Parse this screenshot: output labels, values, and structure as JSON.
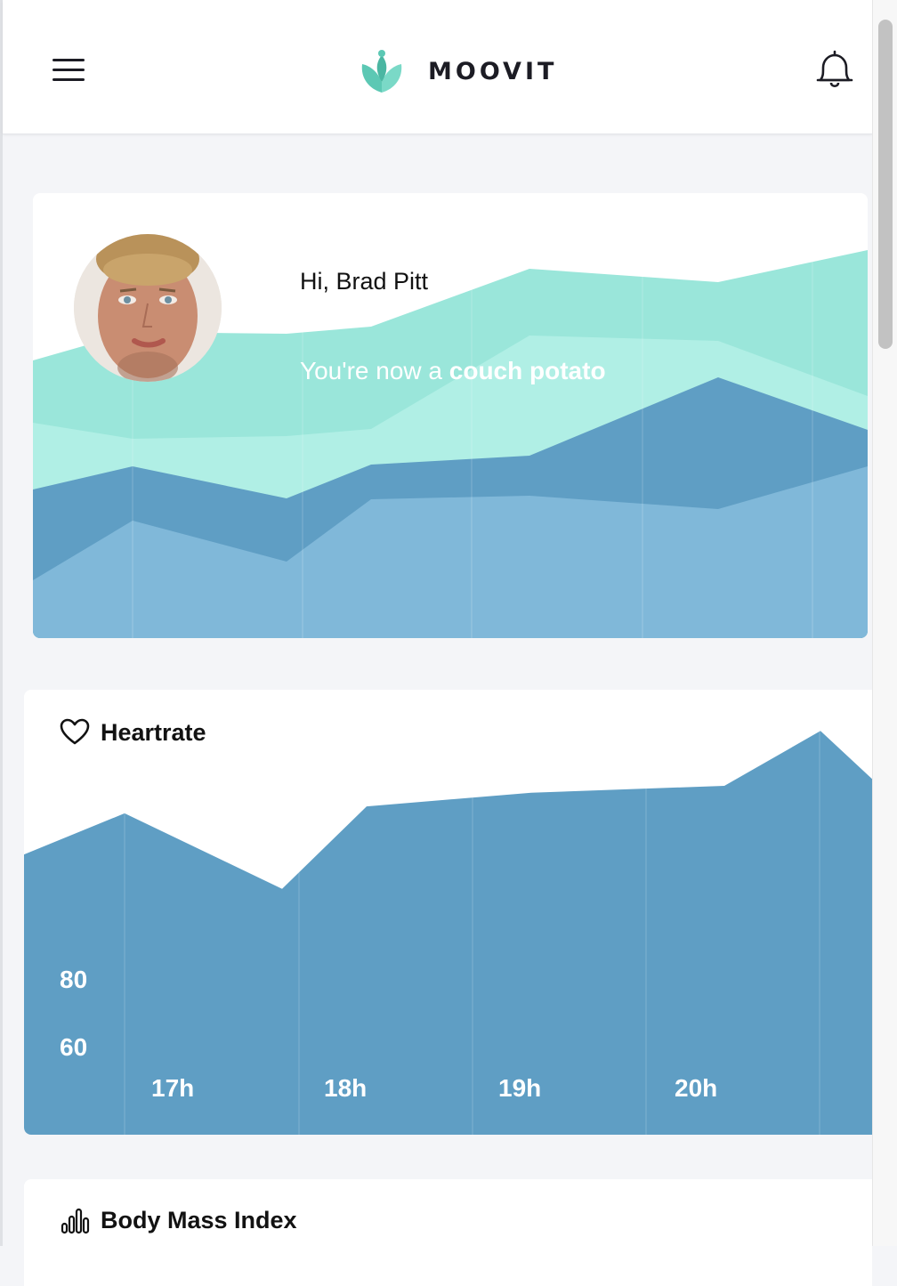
{
  "app": {
    "title": "MOOVIT",
    "menu_icon": "hamburger-menu-icon",
    "notification_icon": "bell-icon",
    "brand_color": "#6fd3c0"
  },
  "hero": {
    "greeting": "Hi, Brad Pitt",
    "status_prefix": "You're now a ",
    "status_highlight": "couch potato",
    "avatar_alt": "profile photo",
    "colors": [
      "#9ae6da",
      "#b0efe5",
      "#5f9ec4",
      "#80b8d9"
    ]
  },
  "heartrate": {
    "title": "Heartrate",
    "icon": "heart-icon",
    "color": "#5f9ec4"
  },
  "bmi": {
    "title": "Body Mass Index",
    "icon": "bar-chart-icon"
  },
  "chart_data": {
    "type": "area",
    "title": "Heartrate",
    "x": [
      "16.5h",
      "17h",
      "18h",
      "18.5h",
      "19h",
      "19.5h",
      "20h",
      "20.5h"
    ],
    "tick_labels": [
      "17h",
      "18h",
      "19h",
      "20h"
    ],
    "y_tick_labels": [
      "80",
      "60"
    ],
    "series": [
      {
        "values": [
          86,
          92,
          81,
          93,
          95,
          96,
          104,
          97
        ]
      }
    ],
    "ylim": [
      40,
      110
    ],
    "grid": "vertical"
  }
}
